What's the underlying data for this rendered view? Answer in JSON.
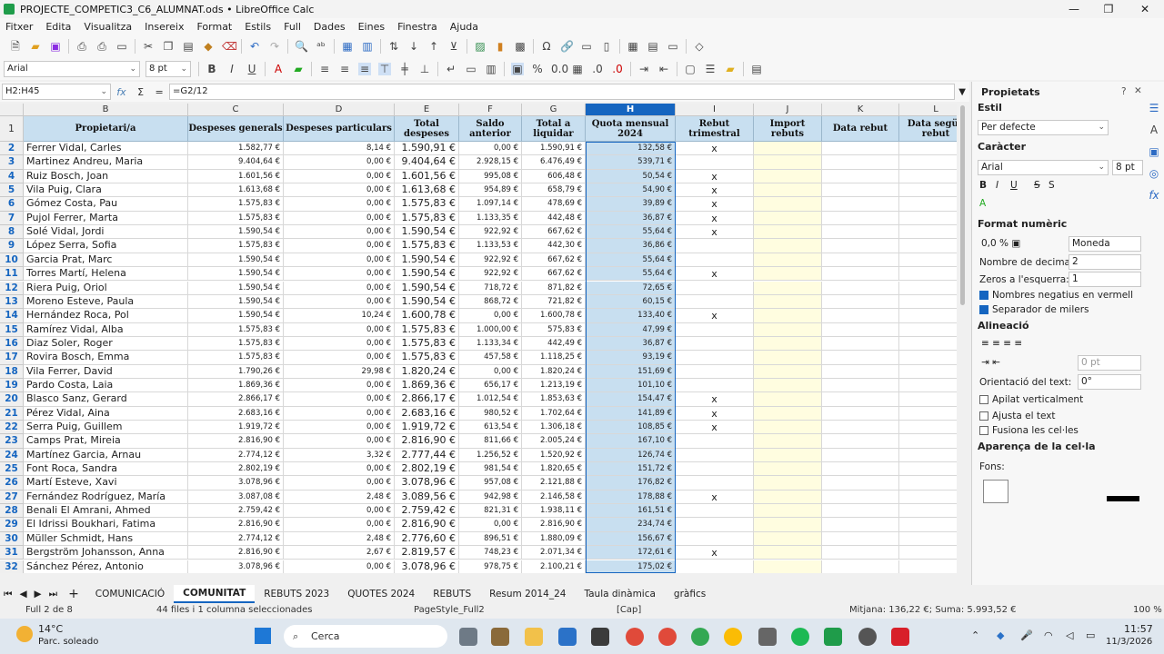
{
  "window": {
    "title": "PROJECTE_COMPETIC3_C6_ALUMNAT.ods • LibreOffice Calc",
    "minimize": "—",
    "maximize": "❐",
    "close": "✕"
  },
  "menu": [
    "Fitxer",
    "Edita",
    "Visualitza",
    "Insereix",
    "Format",
    "Estils",
    "Full",
    "Dades",
    "Eines",
    "Finestra",
    "Ajuda"
  ],
  "toolbar": {
    "font_name": "Arial",
    "font_size": "8 pt"
  },
  "formula_bar": {
    "name_box": "H2:H45",
    "fx": "fx",
    "sigma": "Σ",
    "equals": "=",
    "formula": "=G2/12"
  },
  "columns": [
    {
      "letter": "B",
      "header": "Propietari/a"
    },
    {
      "letter": "C",
      "header": "Despeses generals"
    },
    {
      "letter": "D",
      "header": "Despeses particulars"
    },
    {
      "letter": "E",
      "header": "Total despeses"
    },
    {
      "letter": "F",
      "header": "Saldo anterior"
    },
    {
      "letter": "G",
      "header": "Total a liquidar"
    },
    {
      "letter": "H",
      "header": "Quota mensual 2024"
    },
    {
      "letter": "I",
      "header": "Rebut trimestral"
    },
    {
      "letter": "J",
      "header": "Import rebuts"
    },
    {
      "letter": "K",
      "header": "Data rebut"
    },
    {
      "letter": "L",
      "header": "Data següe rebut"
    }
  ],
  "rows": [
    {
      "n": "2",
      "name": "Ferrer Vidal, Carles",
      "c": "1.582,77 €",
      "d": "8,14 €",
      "e": "1.590,91 €",
      "f": "0,00 €",
      "g": "1.590,91 €",
      "h": "132,58 €",
      "i": "x"
    },
    {
      "n": "3",
      "name": "Martinez Andreu, Maria",
      "c": "9.404,64 €",
      "d": "0,00 €",
      "e": "9.404,64 €",
      "f": "2.928,15 €",
      "g": "6.476,49 €",
      "h": "539,71 €",
      "i": ""
    },
    {
      "n": "4",
      "name": "Ruiz Bosch, Joan",
      "c": "1.601,56 €",
      "d": "0,00 €",
      "e": "1.601,56 €",
      "f": "995,08 €",
      "g": "606,48 €",
      "h": "50,54 €",
      "i": "x"
    },
    {
      "n": "5",
      "name": "Vila Puig, Clara",
      "c": "1.613,68 €",
      "d": "0,00 €",
      "e": "1.613,68 €",
      "f": "954,89 €",
      "g": "658,79 €",
      "h": "54,90 €",
      "i": "x"
    },
    {
      "n": "6",
      "name": "Gómez Costa, Pau",
      "c": "1.575,83 €",
      "d": "0,00 €",
      "e": "1.575,83 €",
      "f": "1.097,14 €",
      "g": "478,69 €",
      "h": "39,89 €",
      "i": "x"
    },
    {
      "n": "7",
      "name": "Pujol Ferrer, Marta",
      "c": "1.575,83 €",
      "d": "0,00 €",
      "e": "1.575,83 €",
      "f": "1.133,35 €",
      "g": "442,48 €",
      "h": "36,87 €",
      "i": "x"
    },
    {
      "n": "8",
      "name": "Solé Vidal, Jordi",
      "c": "1.590,54 €",
      "d": "0,00 €",
      "e": "1.590,54 €",
      "f": "922,92 €",
      "g": "667,62 €",
      "h": "55,64 €",
      "i": "x"
    },
    {
      "n": "9",
      "name": "López Serra, Sofia",
      "c": "1.575,83 €",
      "d": "0,00 €",
      "e": "1.575,83 €",
      "f": "1.133,53 €",
      "g": "442,30 €",
      "h": "36,86 €",
      "i": ""
    },
    {
      "n": "10",
      "name": "Garcia Prat, Marc",
      "c": "1.590,54 €",
      "d": "0,00 €",
      "e": "1.590,54 €",
      "f": "922,92 €",
      "g": "667,62 €",
      "h": "55,64 €",
      "i": ""
    },
    {
      "n": "11",
      "name": "Torres Martí, Helena",
      "c": "1.590,54 €",
      "d": "0,00 €",
      "e": "1.590,54 €",
      "f": "922,92 €",
      "g": "667,62 €",
      "h": "55,64 €",
      "i": "x"
    },
    {
      "n": "12",
      "name": "Riera Puig, Oriol",
      "c": "1.590,54 €",
      "d": "0,00 €",
      "e": "1.590,54 €",
      "f": "718,72 €",
      "g": "871,82 €",
      "h": "72,65 €",
      "i": ""
    },
    {
      "n": "13",
      "name": "Moreno Esteve, Paula",
      "c": "1.590,54 €",
      "d": "0,00 €",
      "e": "1.590,54 €",
      "f": "868,72 €",
      "g": "721,82 €",
      "h": "60,15 €",
      "i": ""
    },
    {
      "n": "14",
      "name": "Hernández Roca, Pol",
      "c": "1.590,54 €",
      "d": "10,24 €",
      "e": "1.600,78 €",
      "f": "0,00 €",
      "g": "1.600,78 €",
      "h": "133,40 €",
      "i": "x"
    },
    {
      "n": "15",
      "name": "Ramírez Vidal, Alba",
      "c": "1.575,83 €",
      "d": "0,00 €",
      "e": "1.575,83 €",
      "f": "1.000,00 €",
      "g": "575,83 €",
      "h": "47,99 €",
      "i": ""
    },
    {
      "n": "16",
      "name": "Diaz Soler, Roger",
      "c": "1.575,83 €",
      "d": "0,00 €",
      "e": "1.575,83 €",
      "f": "1.133,34 €",
      "g": "442,49 €",
      "h": "36,87 €",
      "i": ""
    },
    {
      "n": "17",
      "name": "Rovira Bosch, Emma",
      "c": "1.575,83 €",
      "d": "0,00 €",
      "e": "1.575,83 €",
      "f": "457,58 €",
      "g": "1.118,25 €",
      "h": "93,19 €",
      "i": ""
    },
    {
      "n": "18",
      "name": "Vila Ferrer, David",
      "c": "1.790,26 €",
      "d": "29,98 €",
      "e": "1.820,24 €",
      "f": "0,00 €",
      "g": "1.820,24 €",
      "h": "151,69 €",
      "i": ""
    },
    {
      "n": "19",
      "name": "Pardo Costa, Laia",
      "c": "1.869,36 €",
      "d": "0,00 €",
      "e": "1.869,36 €",
      "f": "656,17 €",
      "g": "1.213,19 €",
      "h": "101,10 €",
      "i": ""
    },
    {
      "n": "20",
      "name": "Blasco Sanz, Gerard",
      "c": "2.866,17 €",
      "d": "0,00 €",
      "e": "2.866,17 €",
      "f": "1.012,54 €",
      "g": "1.853,63 €",
      "h": "154,47 €",
      "i": "x"
    },
    {
      "n": "21",
      "name": "Pérez Vidal, Aina",
      "c": "2.683,16 €",
      "d": "0,00 €",
      "e": "2.683,16 €",
      "f": "980,52 €",
      "g": "1.702,64 €",
      "h": "141,89 €",
      "i": "x"
    },
    {
      "n": "22",
      "name": "Serra Puig, Guillem",
      "c": "1.919,72 €",
      "d": "0,00 €",
      "e": "1.919,72 €",
      "f": "613,54 €",
      "g": "1.306,18 €",
      "h": "108,85 €",
      "i": "x"
    },
    {
      "n": "23",
      "name": "Camps Prat, Mireia",
      "c": "2.816,90 €",
      "d": "0,00 €",
      "e": "2.816,90 €",
      "f": "811,66 €",
      "g": "2.005,24 €",
      "h": "167,10 €",
      "i": ""
    },
    {
      "n": "24",
      "name": "Martínez Garcia, Arnau",
      "c": "2.774,12 €",
      "d": "3,32 €",
      "e": "2.777,44 €",
      "f": "1.256,52 €",
      "g": "1.520,92 €",
      "h": "126,74 €",
      "i": ""
    },
    {
      "n": "25",
      "name": "Font Roca, Sandra",
      "c": "2.802,19 €",
      "d": "0,00 €",
      "e": "2.802,19 €",
      "f": "981,54 €",
      "g": "1.820,65 €",
      "h": "151,72 €",
      "i": ""
    },
    {
      "n": "26",
      "name": "Martí Esteve, Xavi",
      "c": "3.078,96 €",
      "d": "0,00 €",
      "e": "3.078,96 €",
      "f": "957,08 €",
      "g": "2.121,88 €",
      "h": "176,82 €",
      "i": ""
    },
    {
      "n": "27",
      "name": "Fernández Rodríguez, María",
      "c": "3.087,08 €",
      "d": "2,48 €",
      "e": "3.089,56 €",
      "f": "942,98 €",
      "g": "2.146,58 €",
      "h": "178,88 €",
      "i": "x"
    },
    {
      "n": "28",
      "name": "Benali El Amrani, Ahmed",
      "c": "2.759,42 €",
      "d": "0,00 €",
      "e": "2.759,42 €",
      "f": "821,31 €",
      "g": "1.938,11 €",
      "h": "161,51 €",
      "i": ""
    },
    {
      "n": "29",
      "name": "El Idrissi Boukhari, Fatima",
      "c": "2.816,90 €",
      "d": "0,00 €",
      "e": "2.816,90 €",
      "f": "0,00 €",
      "g": "2.816,90 €",
      "h": "234,74 €",
      "i": ""
    },
    {
      "n": "30",
      "name": "Müller Schmidt, Hans",
      "c": "2.774,12 €",
      "d": "2,48 €",
      "e": "2.776,60 €",
      "f": "896,51 €",
      "g": "1.880,09 €",
      "h": "156,67 €",
      "i": ""
    },
    {
      "n": "31",
      "name": "Bergström Johansson, Anna",
      "c": "2.816,90 €",
      "d": "2,67 €",
      "e": "2.819,57 €",
      "f": "748,23 €",
      "g": "2.071,34 €",
      "h": "172,61 €",
      "i": "x"
    },
    {
      "n": "32",
      "name": "Sánchez Pérez, Antonio",
      "c": "3.078,96 €",
      "d": "0,00 €",
      "e": "3.078,96 €",
      "f": "978,75 €",
      "g": "2.100,21 €",
      "h": "175,02 €",
      "i": ""
    }
  ],
  "sidebar": {
    "title": "Propietats",
    "estil": "Estil",
    "estil_value": "Per defecte",
    "caracter": "Caràcter",
    "font": "Arial",
    "size": "8 pt",
    "format_numeric": "Format numèric",
    "format_value": "Moneda",
    "decimals_label": "Nombre de decimals:",
    "decimals_value": "2",
    "zeros_label": "Zeros a l'esquerra:",
    "zeros_value": "1",
    "neg_red": "Nombres negatius en vermell",
    "thousands": "Separador de milers",
    "alineacio": "Alineació",
    "indent_value": "0 pt",
    "orient_label": "Orientació del text:",
    "orient_value": "0°",
    "stack": "Apilat verticalment",
    "wrap": "Ajusta el text",
    "merge": "Fusiona les cel·les",
    "aparenca": "Aparença de la cel·la",
    "fons": "Fons:"
  },
  "tabs": [
    "COMUNICACIÓ",
    "COMUNITAT",
    "REBUTS 2023",
    "QUOTES 2024",
    "REBUTS",
    "Resum 2014_24",
    "Taula dinàmica",
    "gràfics"
  ],
  "active_tab": "COMUNITAT",
  "status": {
    "sheet": "Full 2 de 8",
    "selection": "44 files i 1 columna seleccionades",
    "page_style": "PageStyle_Full2",
    "caps": "[Cap]",
    "sum": "Mitjana: 136,22 €; Suma: 5.993,52 €",
    "zoom": "100 %"
  },
  "taskbar": {
    "temp": "14°C",
    "weather": "Parc. soleado",
    "search": "Cerca",
    "time": "11:57",
    "date": "11/3/2026"
  }
}
